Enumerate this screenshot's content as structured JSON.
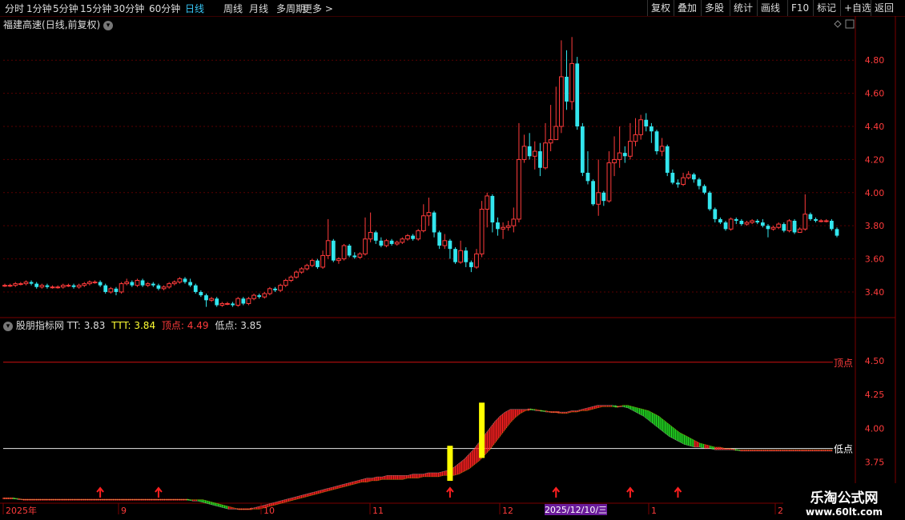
{
  "toolbar": {
    "periods": [
      "分时",
      "1分钟",
      "5分钟",
      "15分钟",
      "30分钟",
      "60分钟",
      "日线",
      "周线",
      "月线",
      "多周期",
      "更多 >"
    ],
    "active": "日线",
    "right_buttons": [
      "复权",
      "叠加",
      "多股",
      "统计",
      "画线",
      "F10",
      "标记",
      "+自选",
      "返回"
    ]
  },
  "stock": {
    "name": "福建高速",
    "mode": "(日线,前复权)"
  },
  "indicator": {
    "name": "股朋指标网",
    "tt_label": "TT:",
    "tt_value": "3.83",
    "ttt_label": "TTT:",
    "ttt_value": "3.84",
    "top_label": "顶点:",
    "top_value": "4.49",
    "low_label": "低点:",
    "low_value": "3.85",
    "top_line_label": "顶点",
    "low_line_label": "低点"
  },
  "price_axis": [
    "4.80",
    "4.60",
    "4.40",
    "4.20",
    "4.00",
    "3.80",
    "3.60",
    "3.40"
  ],
  "ind_axis": [
    "4.50",
    "4.25",
    "4.00",
    "3.75",
    "3.50"
  ],
  "time_axis": [
    "2025年",
    "9",
    "10",
    "11",
    "12",
    "2025/12/10/三",
    "1",
    "2"
  ],
  "watermark": {
    "line1": "乐淘公式网",
    "line2": "www.60lt.com"
  },
  "colors": {
    "up": "#ff3b3b",
    "down": "#33e6ee",
    "grid": "#5a0000",
    "signal": "#ffff00"
  },
  "chart_data": {
    "type": "candlestick",
    "candles": [
      [
        3.44,
        3.44,
        3.45,
        3.43
      ],
      [
        3.44,
        3.44,
        3.45,
        3.43
      ],
      [
        3.44,
        3.45,
        3.46,
        3.43
      ],
      [
        3.45,
        3.45,
        3.46,
        3.44
      ],
      [
        3.45,
        3.46,
        3.47,
        3.44
      ],
      [
        3.46,
        3.45,
        3.47,
        3.44
      ],
      [
        3.45,
        3.43,
        3.46,
        3.42
      ],
      [
        3.43,
        3.44,
        3.45,
        3.42
      ],
      [
        3.44,
        3.43,
        3.45,
        3.42
      ],
      [
        3.43,
        3.43,
        3.44,
        3.42
      ],
      [
        3.43,
        3.43,
        3.44,
        3.42
      ],
      [
        3.43,
        3.44,
        3.45,
        3.42
      ],
      [
        3.44,
        3.44,
        3.45,
        3.43
      ],
      [
        3.44,
        3.43,
        3.45,
        3.42
      ],
      [
        3.43,
        3.44,
        3.45,
        3.42
      ],
      [
        3.44,
        3.45,
        3.46,
        3.43
      ],
      [
        3.45,
        3.46,
        3.47,
        3.44
      ],
      [
        3.46,
        3.46,
        3.47,
        3.45
      ],
      [
        3.46,
        3.44,
        3.47,
        3.43
      ],
      [
        3.44,
        3.4,
        3.45,
        3.39
      ],
      [
        3.4,
        3.42,
        3.43,
        3.39
      ],
      [
        3.42,
        3.4,
        3.43,
        3.38
      ],
      [
        3.4,
        3.45,
        3.46,
        3.39
      ],
      [
        3.45,
        3.46,
        3.48,
        3.44
      ],
      [
        3.46,
        3.44,
        3.47,
        3.43
      ],
      [
        3.44,
        3.47,
        3.48,
        3.43
      ],
      [
        3.47,
        3.44,
        3.48,
        3.43
      ],
      [
        3.44,
        3.45,
        3.46,
        3.43
      ],
      [
        3.45,
        3.44,
        3.46,
        3.43
      ],
      [
        3.44,
        3.42,
        3.45,
        3.41
      ],
      [
        3.42,
        3.43,
        3.44,
        3.41
      ],
      [
        3.43,
        3.45,
        3.46,
        3.42
      ],
      [
        3.45,
        3.46,
        3.47,
        3.44
      ],
      [
        3.46,
        3.48,
        3.49,
        3.45
      ],
      [
        3.48,
        3.46,
        3.49,
        3.45
      ],
      [
        3.46,
        3.44,
        3.48,
        3.43
      ],
      [
        3.44,
        3.4,
        3.45,
        3.39
      ],
      [
        3.4,
        3.38,
        3.41,
        3.37
      ],
      [
        3.38,
        3.35,
        3.39,
        3.31
      ],
      [
        3.35,
        3.36,
        3.37,
        3.34
      ],
      [
        3.36,
        3.32,
        3.37,
        3.31
      ],
      [
        3.32,
        3.33,
        3.34,
        3.31
      ],
      [
        3.33,
        3.33,
        3.34,
        3.32
      ],
      [
        3.33,
        3.32,
        3.34,
        3.31
      ],
      [
        3.32,
        3.36,
        3.37,
        3.31
      ],
      [
        3.36,
        3.33,
        3.37,
        3.32
      ],
      [
        3.33,
        3.36,
        3.37,
        3.32
      ],
      [
        3.36,
        3.38,
        3.39,
        3.35
      ],
      [
        3.38,
        3.37,
        3.39,
        3.36
      ],
      [
        3.37,
        3.39,
        3.4,
        3.36
      ],
      [
        3.39,
        3.42,
        3.43,
        3.38
      ],
      [
        3.42,
        3.41,
        3.43,
        3.4
      ],
      [
        3.41,
        3.44,
        3.45,
        3.4
      ],
      [
        3.44,
        3.47,
        3.48,
        3.43
      ],
      [
        3.47,
        3.49,
        3.5,
        3.46
      ],
      [
        3.49,
        3.52,
        3.53,
        3.48
      ],
      [
        3.52,
        3.54,
        3.55,
        3.51
      ],
      [
        3.54,
        3.56,
        3.57,
        3.53
      ],
      [
        3.56,
        3.59,
        3.6,
        3.55
      ],
      [
        3.59,
        3.55,
        3.6,
        3.54
      ],
      [
        3.55,
        3.62,
        3.65,
        3.54
      ],
      [
        3.62,
        3.71,
        3.84,
        3.6
      ],
      [
        3.71,
        3.59,
        3.72,
        3.58
      ],
      [
        3.59,
        3.6,
        3.61,
        3.57
      ],
      [
        3.6,
        3.68,
        3.69,
        3.59
      ],
      [
        3.68,
        3.62,
        3.69,
        3.61
      ],
      [
        3.62,
        3.61,
        3.64,
        3.6
      ],
      [
        3.61,
        3.63,
        3.64,
        3.6
      ],
      [
        3.63,
        3.72,
        3.85,
        3.62
      ],
      [
        3.72,
        3.76,
        3.88,
        3.7
      ],
      [
        3.76,
        3.71,
        3.77,
        3.69
      ],
      [
        3.71,
        3.68,
        3.73,
        3.67
      ],
      [
        3.68,
        3.71,
        3.72,
        3.67
      ],
      [
        3.71,
        3.69,
        3.72,
        3.68
      ],
      [
        3.69,
        3.7,
        3.71,
        3.68
      ],
      [
        3.7,
        3.72,
        3.73,
        3.69
      ],
      [
        3.72,
        3.74,
        3.75,
        3.71
      ],
      [
        3.74,
        3.72,
        3.75,
        3.71
      ],
      [
        3.72,
        3.77,
        3.78,
        3.71
      ],
      [
        3.77,
        3.86,
        3.93,
        3.76
      ],
      [
        3.86,
        3.88,
        3.97,
        3.8
      ],
      [
        3.88,
        3.76,
        3.89,
        3.73
      ],
      [
        3.76,
        3.68,
        3.77,
        3.66
      ],
      [
        3.68,
        3.71,
        3.75,
        3.66
      ],
      [
        3.71,
        3.66,
        3.72,
        3.6
      ],
      [
        3.66,
        3.58,
        3.67,
        3.57
      ],
      [
        3.58,
        3.65,
        3.71,
        3.57
      ],
      [
        3.65,
        3.58,
        3.67,
        3.55
      ],
      [
        3.58,
        3.55,
        3.59,
        3.52
      ],
      [
        3.55,
        3.63,
        3.66,
        3.54
      ],
      [
        3.63,
        3.9,
        3.95,
        3.61
      ],
      [
        3.9,
        3.98,
        4.0,
        3.79
      ],
      [
        3.98,
        3.82,
        3.99,
        3.76
      ],
      [
        3.82,
        3.78,
        3.85,
        3.74
      ],
      [
        3.78,
        3.79,
        3.82,
        3.72
      ],
      [
        3.79,
        3.8,
        3.83,
        3.77
      ],
      [
        3.8,
        3.84,
        3.91,
        3.76
      ],
      [
        3.84,
        4.2,
        4.42,
        3.82
      ],
      [
        4.2,
        4.28,
        4.35,
        4.18
      ],
      [
        4.28,
        4.22,
        4.36,
        4.2
      ],
      [
        4.22,
        4.25,
        4.31,
        4.14
      ],
      [
        4.25,
        4.15,
        4.3,
        4.1
      ],
      [
        4.15,
        4.3,
        4.42,
        4.14
      ],
      [
        4.3,
        4.32,
        4.53,
        4.25
      ],
      [
        4.32,
        4.4,
        4.64,
        4.33
      ],
      [
        4.4,
        4.7,
        4.92,
        4.36
      ],
      [
        4.7,
        4.55,
        4.86,
        4.5
      ],
      [
        4.55,
        4.78,
        4.94,
        4.5
      ],
      [
        4.78,
        4.4,
        4.82,
        4.38
      ],
      [
        4.4,
        4.12,
        4.42,
        4.1
      ],
      [
        4.12,
        4.07,
        4.25,
        4.05
      ],
      [
        4.07,
        3.93,
        4.08,
        3.92
      ],
      [
        3.93,
        4.0,
        4.2,
        3.86
      ],
      [
        4.0,
        3.95,
        4.01,
        3.92
      ],
      [
        3.95,
        4.18,
        4.25,
        3.94
      ],
      [
        4.18,
        4.2,
        4.34,
        4.1
      ],
      [
        4.2,
        4.24,
        4.4,
        4.15
      ],
      [
        4.24,
        4.22,
        4.28,
        4.18
      ],
      [
        4.22,
        4.31,
        4.42,
        4.2
      ],
      [
        4.31,
        4.35,
        4.45,
        4.28
      ],
      [
        4.35,
        4.44,
        4.47,
        4.32
      ],
      [
        4.44,
        4.4,
        4.48,
        4.37
      ],
      [
        4.4,
        4.37,
        4.42,
        4.3
      ],
      [
        4.37,
        4.25,
        4.38,
        4.23
      ],
      [
        4.25,
        4.28,
        4.33,
        4.22
      ],
      [
        4.28,
        4.12,
        4.29,
        4.1
      ],
      [
        4.12,
        4.06,
        4.14,
        4.05
      ],
      [
        4.06,
        4.05,
        4.08,
        4.03
      ],
      [
        4.05,
        4.09,
        4.12,
        4.04
      ],
      [
        4.09,
        4.11,
        4.13,
        4.08
      ],
      [
        4.11,
        4.08,
        4.12,
        4.06
      ],
      [
        4.08,
        4.04,
        4.09,
        4.02
      ],
      [
        4.04,
        4.0,
        4.05,
        3.99
      ],
      [
        4.0,
        3.9,
        4.01,
        3.89
      ],
      [
        3.9,
        3.84,
        3.91,
        3.82
      ],
      [
        3.84,
        3.82,
        3.85,
        3.81
      ],
      [
        3.82,
        3.78,
        3.83,
        3.77
      ],
      [
        3.78,
        3.84,
        3.85,
        3.77
      ],
      [
        3.84,
        3.83,
        3.85,
        3.81
      ],
      [
        3.83,
        3.81,
        3.84,
        3.8
      ],
      [
        3.81,
        3.82,
        3.83,
        3.8
      ],
      [
        3.82,
        3.83,
        3.84,
        3.81
      ],
      [
        3.83,
        3.82,
        3.84,
        3.81
      ],
      [
        3.82,
        3.8,
        3.84,
        3.79
      ],
      [
        3.8,
        3.78,
        3.81,
        3.73
      ],
      [
        3.78,
        3.79,
        3.8,
        3.77
      ],
      [
        3.79,
        3.81,
        3.82,
        3.78
      ],
      [
        3.81,
        3.77,
        3.82,
        3.76
      ],
      [
        3.77,
        3.83,
        3.84,
        3.76
      ],
      [
        3.83,
        3.76,
        3.84,
        3.75
      ],
      [
        3.76,
        3.78,
        3.79,
        3.76
      ],
      [
        3.78,
        3.87,
        3.99,
        3.77
      ],
      [
        3.87,
        3.84,
        3.88,
        3.83
      ],
      [
        3.84,
        3.83,
        3.85,
        3.82
      ],
      [
        3.83,
        3.83,
        3.84,
        3.82
      ],
      [
        3.83,
        3.83,
        3.84,
        3.82
      ],
      [
        3.83,
        3.78,
        3.84,
        3.77
      ],
      [
        3.78,
        3.74,
        3.79,
        3.73
      ]
    ],
    "tt_series": [
      3.48,
      3.48,
      3.48,
      3.47,
      3.47,
      3.47,
      3.47,
      3.47,
      3.47,
      3.47,
      3.47,
      3.47,
      3.47,
      3.47,
      3.47,
      3.47,
      3.47,
      3.47,
      3.47,
      3.47,
      3.47,
      3.47,
      3.47,
      3.47,
      3.47,
      3.47,
      3.47,
      3.47,
      3.47,
      3.47,
      3.47,
      3.47,
      3.47,
      3.47,
      3.47,
      3.47,
      3.47,
      3.46,
      3.46,
      3.45,
      3.44,
      3.43,
      3.42,
      3.41,
      3.4,
      3.4,
      3.4,
      3.4,
      3.4,
      3.41,
      3.42,
      3.43,
      3.44,
      3.45,
      3.46,
      3.47,
      3.48,
      3.49,
      3.5,
      3.51,
      3.52,
      3.53,
      3.54,
      3.55,
      3.56,
      3.57,
      3.58,
      3.59,
      3.6,
      3.61,
      3.62,
      3.63,
      3.63,
      3.64,
      3.64,
      3.65,
      3.65,
      3.65,
      3.65,
      3.65,
      3.66,
      3.66,
      3.66,
      3.67,
      3.67,
      3.67,
      3.68,
      3.69,
      3.71,
      3.74,
      3.77,
      3.81,
      3.85,
      3.9,
      3.95,
      4.0,
      4.05,
      4.09,
      4.12,
      4.14,
      4.14,
      4.14,
      4.14,
      4.14,
      4.13,
      4.13,
      4.12,
      4.12,
      4.12,
      4.12,
      4.12,
      4.13,
      4.13,
      4.14,
      4.15,
      4.16,
      4.17,
      4.17,
      4.17,
      4.17,
      4.16,
      4.16,
      4.15,
      4.13,
      4.11,
      4.09,
      4.06,
      4.03,
      4.0,
      3.97,
      3.94,
      3.92,
      3.9,
      3.88,
      3.87,
      3.86,
      3.86,
      3.85,
      3.85,
      3.84,
      3.84,
      3.84,
      3.84,
      3.84,
      3.83,
      3.83,
      3.83,
      3.83,
      3.83,
      3.83,
      3.83,
      3.83,
      3.83,
      3.83,
      3.83,
      3.83,
      3.83,
      3.83,
      3.83,
      3.83,
      3.83,
      3.83,
      3.83
    ],
    "ttt_series": [
      3.48,
      3.48,
      3.48,
      3.48,
      3.47,
      3.47,
      3.47,
      3.47,
      3.47,
      3.47,
      3.47,
      3.47,
      3.47,
      3.47,
      3.47,
      3.47,
      3.47,
      3.47,
      3.47,
      3.47,
      3.47,
      3.47,
      3.47,
      3.47,
      3.47,
      3.47,
      3.47,
      3.47,
      3.47,
      3.47,
      3.47,
      3.47,
      3.47,
      3.47,
      3.47,
      3.47,
      3.47,
      3.47,
      3.47,
      3.47,
      3.46,
      3.45,
      3.44,
      3.43,
      3.42,
      3.41,
      3.4,
      3.4,
      3.4,
      3.4,
      3.4,
      3.41,
      3.42,
      3.43,
      3.44,
      3.45,
      3.46,
      3.47,
      3.48,
      3.49,
      3.5,
      3.51,
      3.52,
      3.53,
      3.54,
      3.55,
      3.56,
      3.57,
      3.58,
      3.59,
      3.6,
      3.6,
      3.61,
      3.61,
      3.62,
      3.62,
      3.62,
      3.62,
      3.62,
      3.63,
      3.63,
      3.63,
      3.64,
      3.64,
      3.64,
      3.64,
      3.65,
      3.65,
      3.65,
      3.66,
      3.68,
      3.7,
      3.73,
      3.76,
      3.8,
      3.84,
      3.89,
      3.94,
      3.99,
      4.04,
      4.08,
      4.11,
      4.13,
      4.14,
      4.14,
      4.13,
      4.13,
      4.12,
      4.12,
      4.11,
      4.11,
      4.12,
      4.12,
      4.13,
      4.13,
      4.14,
      4.15,
      4.16,
      4.16,
      4.16,
      4.16,
      4.17,
      4.17,
      4.16,
      4.15,
      4.14,
      4.13,
      4.11,
      4.09,
      4.06,
      4.03,
      4.0,
      3.97,
      3.95,
      3.93,
      3.91,
      3.89,
      3.88,
      3.87,
      3.86,
      3.86,
      3.85,
      3.85,
      3.84,
      3.84,
      3.84,
      3.84,
      3.84,
      3.84,
      3.84,
      3.84,
      3.84,
      3.84,
      3.84,
      3.84,
      3.84,
      3.84,
      3.84,
      3.84,
      3.84,
      3.84,
      3.84,
      3.84
    ],
    "top_level": 4.49,
    "low_level": 3.85,
    "signal_bars": [
      {
        "index": 84,
        "from": 3.61,
        "to": 3.87
      },
      {
        "index": 90,
        "from": 3.78,
        "to": 4.19
      }
    ],
    "up_arrows": [
      18,
      29,
      84,
      104,
      118,
      127
    ],
    "price_range": [
      3.25,
      4.98
    ],
    "ind_range": [
      3.45,
      4.72
    ]
  }
}
